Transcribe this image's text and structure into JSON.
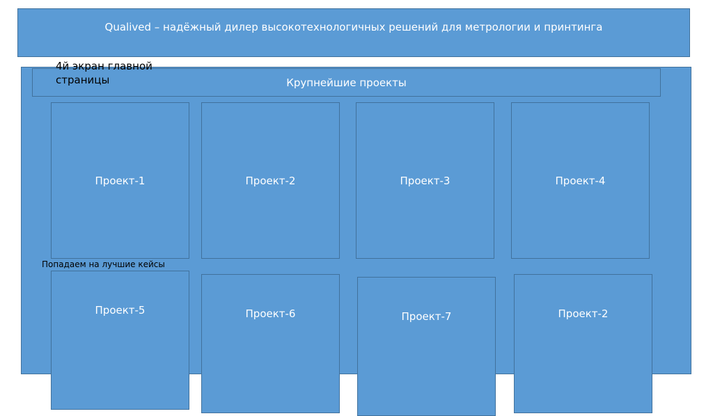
{
  "header": {
    "title": "Qualived – надёжный дилер высокотехнологичных решений для метрологии и принтинга"
  },
  "notes": {
    "screen": "4й экран главной страницы",
    "cases": "Попадаем на лучшие кейсы"
  },
  "section": {
    "title": "Крупнейшие проекты"
  },
  "projects": [
    "Проект-1",
    "Проект-2",
    "Проект-3",
    "Проект-4",
    "Проект-5",
    "Проект-6",
    "Проект-7",
    "Проект-2"
  ],
  "colors": {
    "box_fill": "#5b9bd5",
    "box_border": "#41719c",
    "box_text": "#ffffff",
    "note_text": "#000000"
  }
}
